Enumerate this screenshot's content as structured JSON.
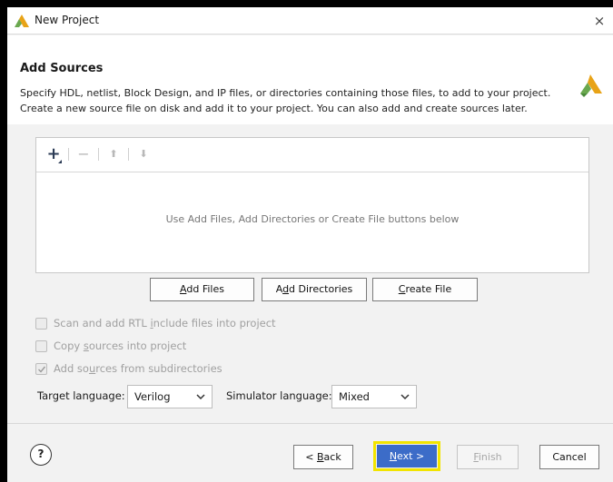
{
  "window": {
    "title": "New Project",
    "close_glyph": "×",
    "icon": "vivado-logo-icon"
  },
  "header": {
    "title": "Add Sources",
    "description_line1": "Specify HDL, netlist, Block Design, and IP files, or directories containing those files, to add to your project.",
    "description_line2": "Create a new source file on disk and add it to your project. You can also add and create sources later.",
    "logo": "vivado-logo-icon"
  },
  "sources_panel": {
    "toolbar": {
      "add_glyph": "+",
      "remove_glyph": "−",
      "up_glyph": "⬆",
      "down_glyph": "⬇"
    },
    "empty_message": "Use Add Files, Add Directories or Create File buttons below"
  },
  "buttons": {
    "add_files": {
      "mnemonic": "A",
      "rest": "dd Files"
    },
    "add_directories": {
      "prefix": "A",
      "mnemonic": "d",
      "rest": "d Directories"
    },
    "create_file": {
      "mnemonic": "C",
      "rest": "reate File"
    }
  },
  "options": {
    "scan_rtl": {
      "prefix": "Scan and add RTL ",
      "mnemonic": "i",
      "rest": "nclude files into project",
      "checked": false,
      "enabled": false
    },
    "copy_sources": {
      "prefix": "Copy ",
      "mnemonic": "s",
      "rest": "ources into project",
      "checked": false,
      "enabled": false
    },
    "add_subdirs": {
      "prefix": "Add so",
      "mnemonic": "u",
      "rest": "rces from subdirectories",
      "checked": true,
      "enabled": false
    }
  },
  "languages": {
    "target_label": "Target language:",
    "target_value": "Verilog",
    "simulator_label": "Simulator language:",
    "simulator_value": "Mixed"
  },
  "footer": {
    "help_glyph": "?",
    "back": {
      "prefix": "< ",
      "mnemonic": "B",
      "rest": "ack"
    },
    "next": {
      "mnemonic": "N",
      "rest": "ext >"
    },
    "finish": {
      "mnemonic": "F",
      "rest": "inish"
    },
    "cancel": "Cancel",
    "highlight_color": "#f2e400",
    "primary_color": "#3c6cc8"
  }
}
